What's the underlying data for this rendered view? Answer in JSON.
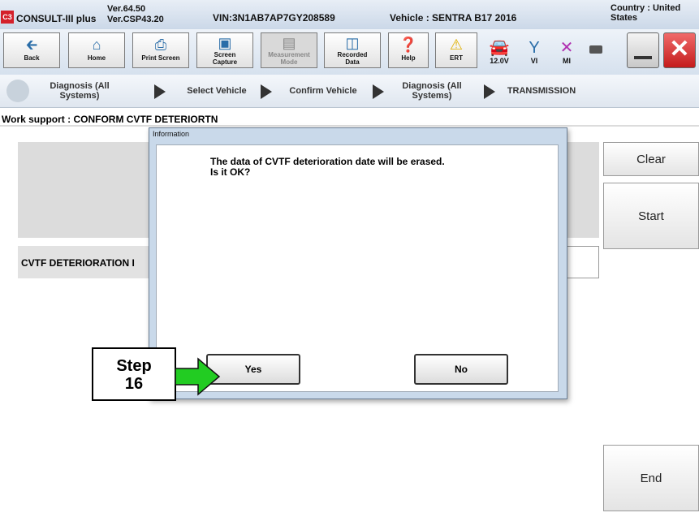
{
  "titlebar": {
    "app": "CONSULT-III plus",
    "ver1": "Ver.64.50",
    "ver2": "Ver.CSP43.20",
    "vin": "VIN:3N1AB7AP7GY208589",
    "vehicle": "Vehicle : SENTRA B17 2016",
    "country1": "Country : United",
    "country2": "States"
  },
  "toolbar": {
    "back": "Back",
    "home": "Home",
    "print": "Print Screen",
    "screen1": "Screen",
    "screen2": "Capture",
    "meas1": "Measurement",
    "meas2": "Mode",
    "rec1": "Recorded",
    "rec2": "Data",
    "help": "Help",
    "ert": "ERT",
    "voltage": "12.0V",
    "vi": "VI",
    "mi": "MI"
  },
  "breadcrumb": {
    "c1a": "Diagnosis (All",
    "c1b": "Systems)",
    "c2": "Select Vehicle",
    "c3": "Confirm Vehicle",
    "c4a": "Diagnosis (All",
    "c4b": "Systems)",
    "c5": "TRANSMISSION"
  },
  "work": {
    "title": "Work support : CONFORM CVTF DETERIORTN",
    "row_label": "CVTF DETERIORATION I",
    "clear": "Clear",
    "start": "Start",
    "end": "End"
  },
  "dialog": {
    "title": "Information",
    "message": "The data of CVTF deterioration date will be erased.\nIs it OK?",
    "yes": "Yes",
    "no": "No"
  },
  "annotation": {
    "step": "Step",
    "num": "16",
    "arrow_color": "#22cc22"
  },
  "colors": {
    "logo": "#d4202a",
    "close": "#e03030",
    "dialog_frame": "#c9d9ea"
  }
}
